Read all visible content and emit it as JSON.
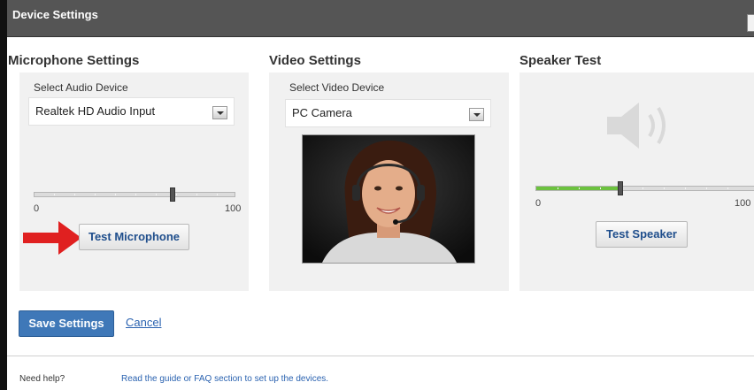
{
  "window": {
    "title": "Device Settings"
  },
  "microphone": {
    "section_title": "Microphone Settings",
    "select_label": "Select Audio Device",
    "selected_device": "Realtek HD Audio Input",
    "slider_min": "0",
    "slider_max": "100",
    "level_percent": 69,
    "test_button": "Test Microphone"
  },
  "video": {
    "section_title": "Video Settings",
    "select_label": "Select Video Device",
    "selected_device": "PC Camera"
  },
  "speaker": {
    "section_title": "Speaker Test",
    "slider_min": "0",
    "slider_max": "100",
    "level_percent": 38,
    "test_button": "Test Speaker"
  },
  "actions": {
    "save_label": "Save Settings",
    "cancel_label": "Cancel"
  },
  "footer": {
    "help_label": "Need help?",
    "help_link": "Read the guide or FAQ section to set up the devices."
  },
  "colors": {
    "titlebar": "#555555",
    "panel_bg": "#f1f1f1",
    "save_button": "#3f78b8",
    "link": "#2a62b0",
    "level_fill": "#6cc23f",
    "pointer_arrow": "#e02020"
  },
  "icons": [
    "speaker-icon",
    "dropdown-arrow-icon",
    "pointer-arrow-icon"
  ]
}
